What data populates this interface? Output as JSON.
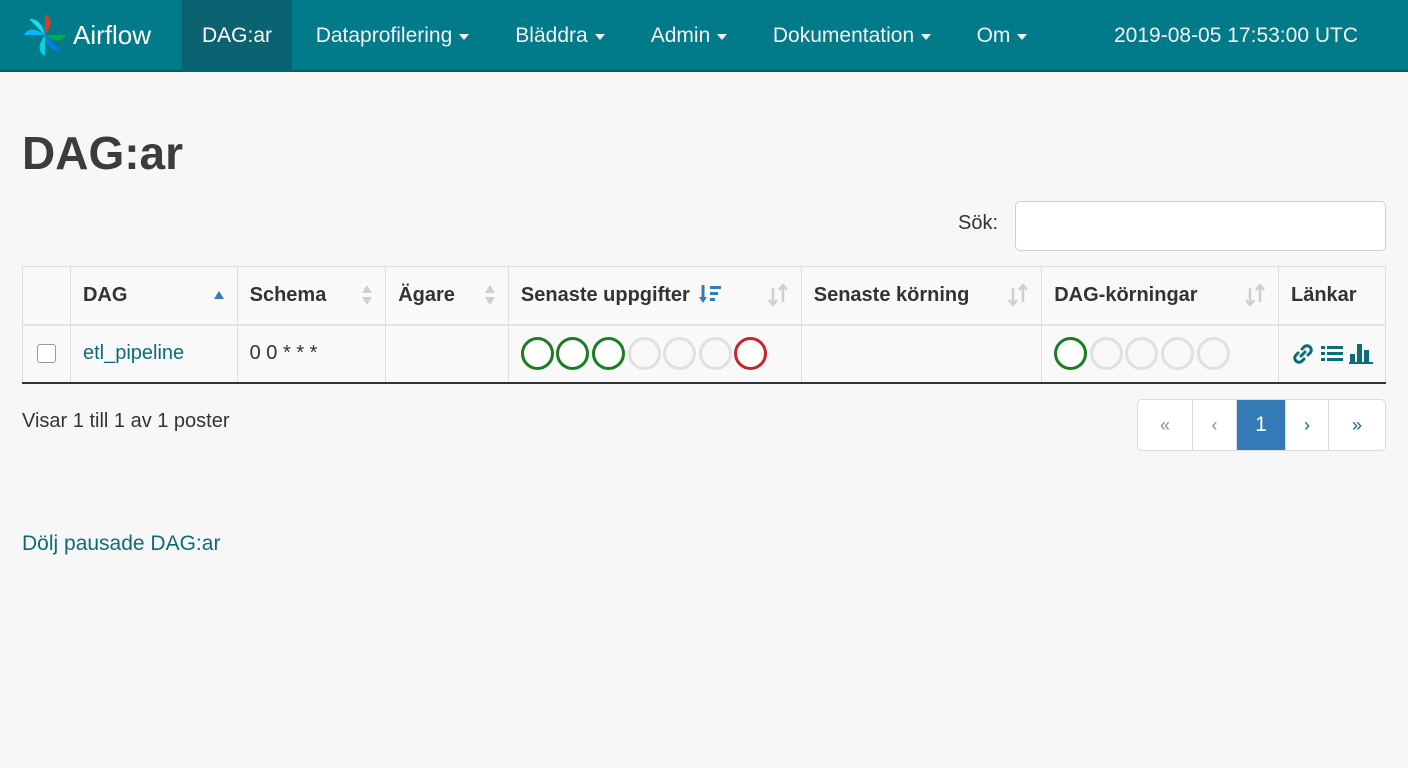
{
  "navbar": {
    "brand": "Airflow",
    "items": [
      {
        "label": "DAG:ar",
        "active": true
      },
      {
        "label": "Dataprofilering",
        "dropdown": true
      },
      {
        "label": "Bläddra",
        "dropdown": true
      },
      {
        "label": "Admin",
        "dropdown": true
      },
      {
        "label": "Dokumentation",
        "dropdown": true
      },
      {
        "label": "Om",
        "dropdown": true
      }
    ],
    "time": "2019-08-05 17:53:00 UTC"
  },
  "page": {
    "title": "DAG:ar"
  },
  "search": {
    "label": "Sök:",
    "value": "",
    "placeholder": ""
  },
  "table": {
    "columns": [
      {
        "label": ""
      },
      {
        "label": "DAG"
      },
      {
        "label": "Schema"
      },
      {
        "label": "Ägare"
      },
      {
        "label": "Senaste uppgifter"
      },
      {
        "label": "Senaste körning"
      },
      {
        "label": "DAG-körningar"
      },
      {
        "label": "Länkar"
      }
    ],
    "rows": [
      {
        "dag": "etl_pipeline",
        "schedule": "0 0 * * *",
        "owner": "",
        "recent_tasks": [
          "success",
          "success",
          "success",
          "none",
          "none",
          "none",
          "failed"
        ],
        "last_run": "",
        "dag_runs": [
          "success",
          "none",
          "none",
          "none",
          "none"
        ],
        "links": [
          "link-icon",
          "list-icon",
          "bar-chart-icon"
        ]
      }
    ]
  },
  "footer": {
    "info": "Visar 1 till 1 av 1 poster",
    "pagination": {
      "first": "«",
      "prev": "‹",
      "current": "1",
      "next": "›",
      "last": "»"
    },
    "toggle_paused": "Dölj pausade DAG:ar"
  },
  "colors": {
    "navbar": "#017b8a",
    "navbar_active": "#0b6271",
    "link": "#0d6c7a",
    "success": "#1c7c22",
    "failed": "#c4262a",
    "pagination_active": "#337ab7"
  }
}
